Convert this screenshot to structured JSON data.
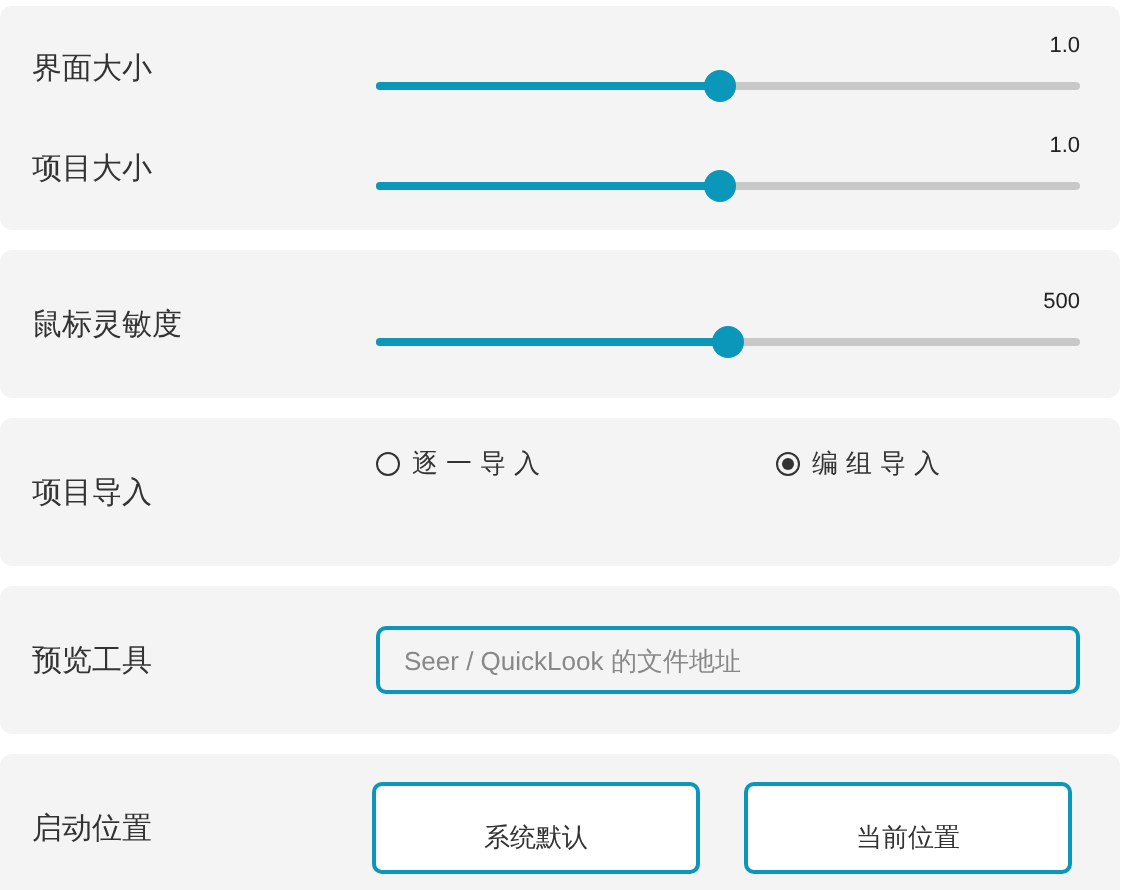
{
  "sections": [
    {
      "kind": "sliders",
      "rows": [
        {
          "label": "界面大小",
          "reading": "1.0",
          "level": 0.49
        },
        {
          "label": "项目大小",
          "reading": "1.0",
          "level": 0.49
        }
      ]
    },
    {
      "kind": "sliders",
      "rows": [
        {
          "label": "鼠标灵敏度",
          "reading": "500",
          "level": 0.5
        }
      ]
    },
    {
      "kind": "radio",
      "label": "项目导入",
      "options": [
        {
          "label": "逐一导入",
          "selected": false
        },
        {
          "label": "编组导入",
          "selected": true
        }
      ]
    },
    {
      "kind": "field",
      "label": "预览工具",
      "placeholder": "Seer / QuickLook 的文件地址"
    },
    {
      "kind": "buttons",
      "label": "启动位置",
      "buttons": [
        "系统默认",
        "当前位置"
      ]
    }
  ]
}
